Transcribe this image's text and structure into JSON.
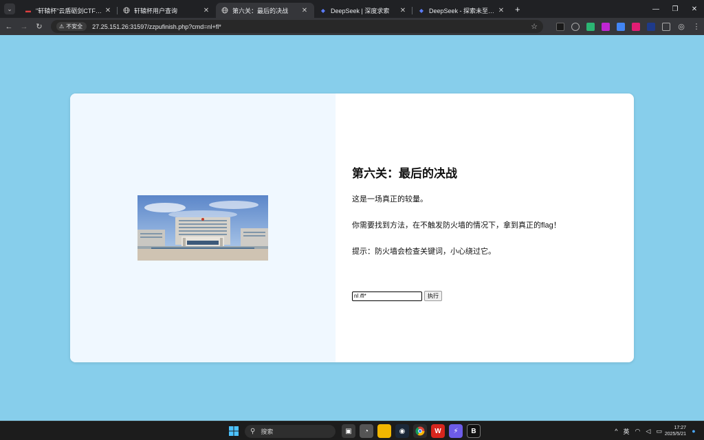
{
  "browser": {
    "tabs": [
      {
        "title": "\"轩辕杯\"云盾砺剑CTF挑战赛",
        "favicon": "ctf-flag-icon",
        "active": false
      },
      {
        "title": "轩辕杯用户查询",
        "favicon": "globe-icon",
        "active": false
      },
      {
        "title": "第六关：最后的决战",
        "favicon": "globe-icon",
        "active": true
      },
      {
        "title": "DeepSeek | 深度求索",
        "favicon": "deepseek-icon",
        "active": false
      },
      {
        "title": "DeepSeek - 探索未至之境",
        "favicon": "deepseek-icon",
        "active": false
      }
    ],
    "security_label": "不安全",
    "url": "27.25.151.26:31597/zzpufinish.php?cmd=nl+fl*"
  },
  "page": {
    "title": "第六关：最后的决战",
    "paragraphs": [
      "这是一场真正的较量。",
      "你需要找到方法，在不触发防火墙的情况下，拿到真正的flag！",
      "提示：防火墙会检查关键词，小心绕过它。"
    ],
    "cmd_value": "nl /fl*",
    "submit_label": "执行",
    "image_alt": "government-building-photo"
  },
  "taskbar": {
    "search_label": "搜索",
    "ime": "英",
    "time": "17:27",
    "date": "2025/5/21"
  },
  "colors": {
    "page_bg": "#87ceeb",
    "card_left_bg": "#f0f8ff",
    "card_right_bg": "#ffffff"
  }
}
